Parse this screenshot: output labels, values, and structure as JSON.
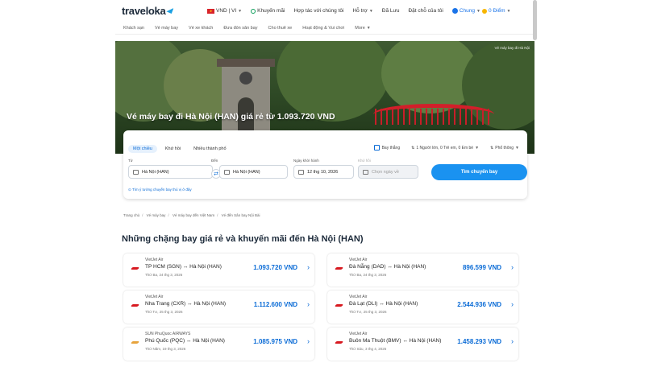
{
  "header": {
    "logo": "traveloka",
    "currency": "VND | VI",
    "promo": "Khuyến mãi",
    "partner": "Hợp tác với chúng tôi",
    "support": "Hỗ trợ",
    "saved": "Đã Lưu",
    "bookings": "Đặt chỗ của tôi",
    "user": "Chung",
    "points": "0 Điểm"
  },
  "subnav": [
    "Khách sạn",
    "Vé máy bay",
    "Vé xe khách",
    "Đưa đón sân bay",
    "Cho thuê xe",
    "Hoạt động & Vui chơi",
    "More"
  ],
  "hero": {
    "title": "Vé máy bay đi Hà Nội (HAN) giá rẻ từ 1.093.720 VND",
    "tag": "Vé máy bay đi Hà Nội"
  },
  "search": {
    "tabs": [
      "Một chiều",
      "Khứ hồi",
      "Nhiều thành phố"
    ],
    "direct": "Bay thẳng",
    "passengers": "1 Người lớn, 0 Trẻ em, 0 Em bé",
    "class": "Phổ thông",
    "from_label": "Từ",
    "from_value": "Hà Nội (HAN)",
    "to_label": "Đến",
    "to_value": "Hà Nội (HAN)",
    "depart_label": "Ngày khởi hành",
    "depart_value": "12 thg 10, 2026",
    "return_label": "Khứ hồi",
    "return_placeholder": "Chọn ngày về",
    "button": "Tìm chuyến bay",
    "map_link": "Tìm ý tưởng chuyến bay thú vị ở đây"
  },
  "breadcrumb": [
    "Trang chủ",
    "Vé máy bay",
    "Vé máy bay đến Việt Nam",
    "Vé đến Sân bay Nội Bài"
  ],
  "section_title": "Những chặng bay giá rẻ và khuyến mãi đến Hà Nội (HAN)",
  "deals": [
    {
      "airline": "VietJet Air",
      "route": "TP HCM  (SGN)  ↔  Hà Nội  (HAN)",
      "date": "Thứ Ba, 24 thg 3, 2026",
      "price": "1.093.720 VND",
      "logo": "vietjet"
    },
    {
      "airline": "VietJet Air",
      "route": "Đà Nẵng  (DAD)  ↔  Hà Nội  (HAN)",
      "date": "Thứ Ba, 24 thg 3, 2026",
      "price": "896.599 VND",
      "logo": "vietjet"
    },
    {
      "airline": "VietJet Air",
      "route": "Nha Trang  (CXR)  ↔  Hà Nội  (HAN)",
      "date": "Thứ Tư, 25 thg 3, 2026",
      "price": "1.112.600 VND",
      "logo": "vietjet"
    },
    {
      "airline": "VietJet Air",
      "route": "Đà Lạt  (DLI)  ↔  Hà Nội  (HAN)",
      "date": "Thứ Tư, 25 thg 3, 2026",
      "price": "2.544.936 VND",
      "logo": "vietjet"
    },
    {
      "airline": "SUN PhuQuoc AIRWAYS",
      "route": "Phú Quốc  (PQC)  ↔  Hà Nội  (HAN)",
      "date": "Thứ Năm, 19 thg 3, 2026",
      "price": "1.085.975 VND",
      "logo": "sun"
    },
    {
      "airline": "VietJet Air",
      "route": "Buôn Ma Thuột  (BMV)  ↔  Hà Nội  (HAN)",
      "date": "Thứ Sáu, 3 thg 4, 2026",
      "price": "1.458.293 VND",
      "logo": "vietjet"
    }
  ]
}
